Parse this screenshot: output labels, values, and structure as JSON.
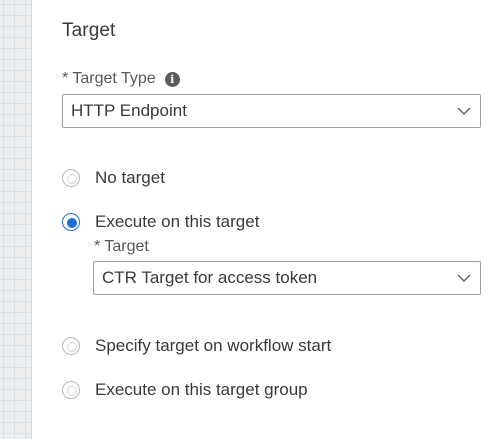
{
  "section": {
    "title": "Target"
  },
  "target_type": {
    "label": "* Target Type",
    "value": "HTTP Endpoint"
  },
  "options": [
    {
      "label": "No target",
      "selected": false
    },
    {
      "label": "Execute on this target",
      "selected": true
    },
    {
      "label": "Specify target on workflow start",
      "selected": false
    },
    {
      "label": "Execute on this target group",
      "selected": false
    }
  ],
  "target": {
    "label": "* Target",
    "value": "CTR Target for access token"
  },
  "colors": {
    "accent": "#1e6fd9",
    "text": "#39393b",
    "border": "#9e9ea2"
  },
  "icons": {
    "info": "info-icon",
    "dropdown": "chevron-down-icon"
  }
}
